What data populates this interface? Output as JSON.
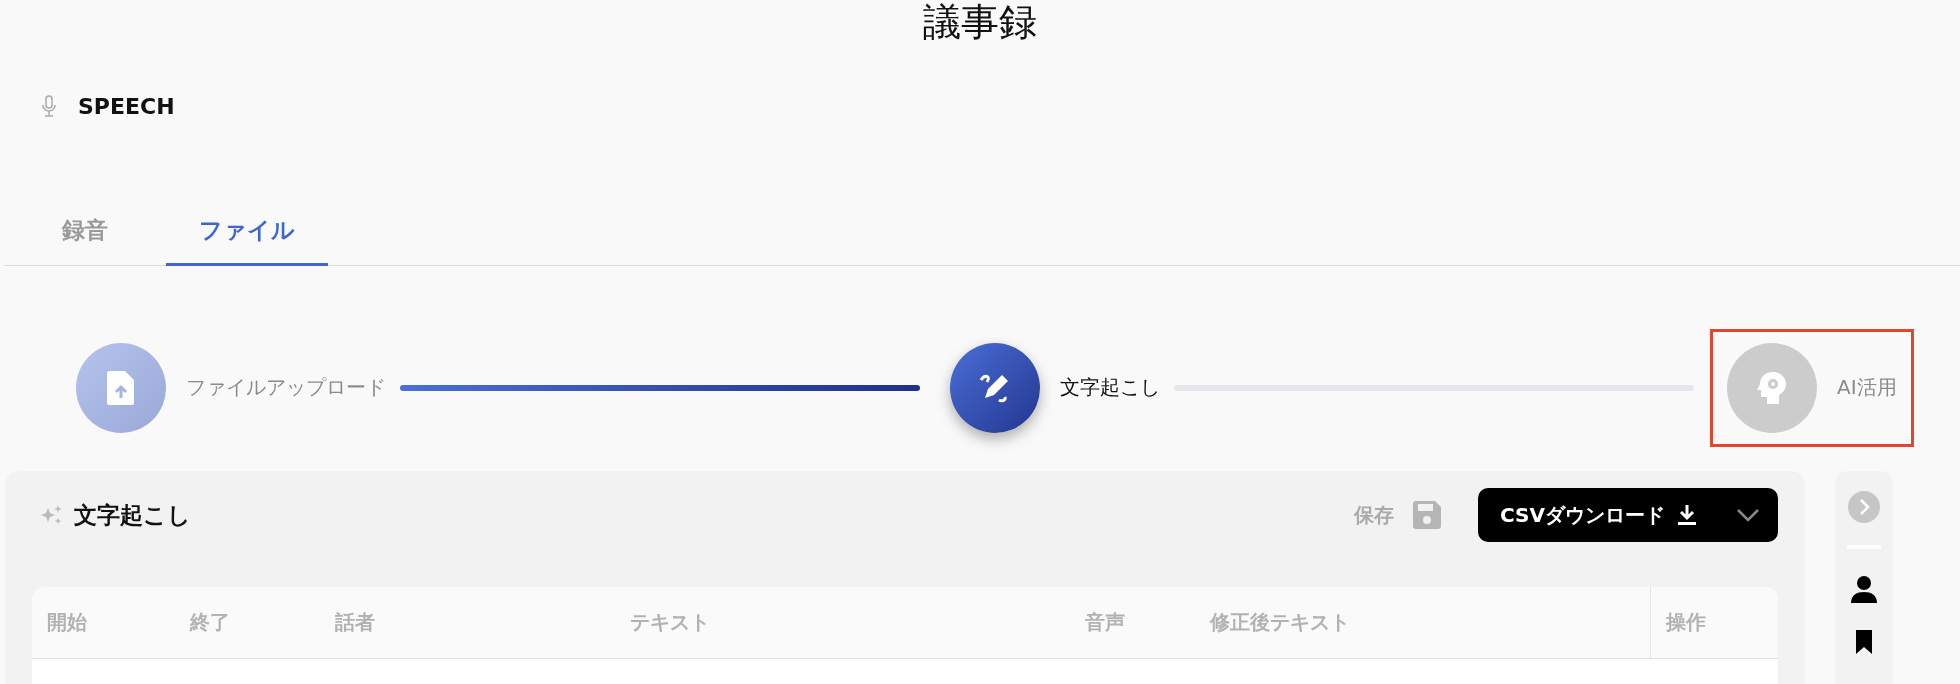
{
  "page_title": "議事録",
  "section": {
    "label": "SPEECH"
  },
  "tabs": [
    {
      "label": "録音",
      "selected": false
    },
    {
      "label": "ファイル",
      "selected": true
    }
  ],
  "steps": [
    {
      "label": "ファイルアップロード",
      "kind": "upload",
      "done": true,
      "current": false,
      "highlighted": false
    },
    {
      "label": "文字起こし",
      "kind": "transcribe",
      "done": false,
      "current": true,
      "highlighted": false
    },
    {
      "label": "AI活用",
      "kind": "ai",
      "done": false,
      "current": false,
      "highlighted": true
    }
  ],
  "connectors": [
    {
      "done": true
    },
    {
      "done": false
    }
  ],
  "panel": {
    "title": "文字起こし",
    "save_label": "保存",
    "download_label": "CSVダウンロード",
    "table": {
      "columns": [
        "開始",
        "終了",
        "話者",
        "テキスト",
        "音声",
        "修正後テキスト",
        "操作"
      ]
    }
  }
}
